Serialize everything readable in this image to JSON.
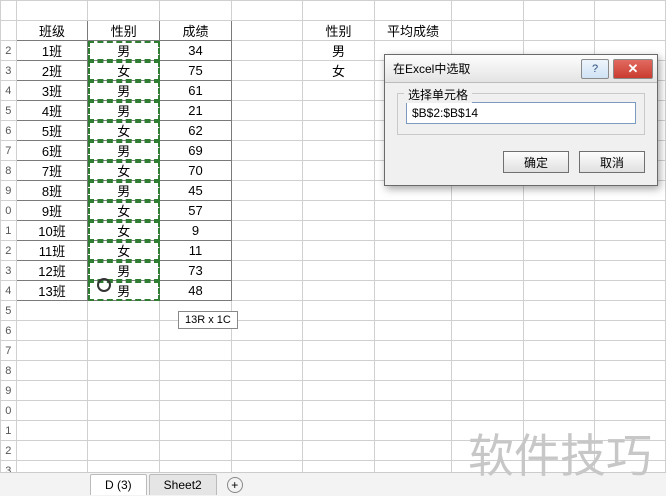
{
  "columns_header": {
    "a": "班级",
    "b": "性别",
    "c": "成绩",
    "e": "性别",
    "f": "平均成绩"
  },
  "rows": [
    {
      "a": "1班",
      "b": "男",
      "c": "34",
      "e": "男"
    },
    {
      "a": "2班",
      "b": "女",
      "c": "75",
      "e": "女"
    },
    {
      "a": "3班",
      "b": "男",
      "c": "61"
    },
    {
      "a": "4班",
      "b": "男",
      "c": "21"
    },
    {
      "a": "5班",
      "b": "女",
      "c": "62"
    },
    {
      "a": "6班",
      "b": "男",
      "c": "69"
    },
    {
      "a": "7班",
      "b": "女",
      "c": "70"
    },
    {
      "a": "8班",
      "b": "男",
      "c": "45"
    },
    {
      "a": "9班",
      "b": "女",
      "c": "57"
    },
    {
      "a": "10班",
      "b": "女",
      "c": "9"
    },
    {
      "a": "11班",
      "b": "女",
      "c": "11"
    },
    {
      "a": "12班",
      "b": "男",
      "c": "73"
    },
    {
      "a": "13班",
      "b": "男",
      "c": "48"
    }
  ],
  "row_numbers_visible": [
    "",
    "2",
    "3",
    "4",
    "5",
    "6",
    "7",
    "8",
    "9",
    "0",
    "1",
    "2",
    "3",
    "4",
    "5",
    "6",
    "7",
    "8",
    "9",
    "0",
    "1",
    "2",
    "3"
  ],
  "selection_tooltip": "13R x 1C",
  "dialog": {
    "title": "在Excel中选取",
    "group_label": "选择单元格",
    "input_value": "$B$2:$B$14",
    "ok": "确定",
    "cancel": "取消",
    "help_glyph": "?",
    "close_glyph": "✕"
  },
  "tabs": {
    "t1": "D (3)",
    "t2": "Sheet2",
    "add": "+"
  },
  "watermark": "软件技巧"
}
